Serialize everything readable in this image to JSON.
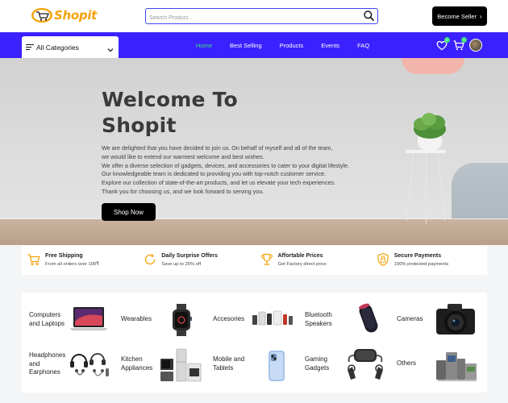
{
  "header": {
    "logo_text": "Shopit",
    "search_placeholder": "Search Product...",
    "become_seller_label": "Become Seller",
    "become_seller_chevron": "›"
  },
  "nav": {
    "categories_label": "All Categories",
    "links": [
      {
        "label": "Home",
        "active": true
      },
      {
        "label": "Best Selling",
        "active": false
      },
      {
        "label": "Products",
        "active": false
      },
      {
        "label": "Events",
        "active": false
      },
      {
        "label": "FAQ",
        "active": false
      }
    ],
    "wishlist_count": "0",
    "cart_count": "0",
    "active_color": "#37e07a",
    "bar_color": "#3b21ff"
  },
  "hero": {
    "title_line1": "Welcome To",
    "title_line2": "Shopit",
    "text_lines": [
      "We are delighted that you have decided to join us. On behalf of myself and all of the team,",
      "we would like to extend our warmest welcome and best wishes.",
      "We offer a diverse selection of gadgets, devices, and accessories to cater to your digital lifestyle.",
      "Our knowledgeable team is dedicated to providing you with top-notch customer service.",
      "Explore our collection of state-of-the-art products, and let us elevate your tech experiences.",
      "Thank you for choosing us, and we look forward to serving you."
    ],
    "button_label": "Shop Now"
  },
  "features": [
    {
      "title": "Free Shipping",
      "subtitle": "From all orders over 100₹",
      "icon": "cart-icon"
    },
    {
      "title": "Daily Surprise Offers",
      "subtitle": "Save up to 25% off",
      "icon": "refresh-icon"
    },
    {
      "title": "Affortable Prices",
      "subtitle": "Get Factory direct price",
      "icon": "trophy-icon"
    },
    {
      "title": "Secure Payments",
      "subtitle": "100% protected payments",
      "icon": "shield-icon"
    }
  ],
  "categories": [
    {
      "name_lines": [
        "Computers",
        "and Laptops"
      ],
      "icon": "laptop-icon"
    },
    {
      "name_lines": [
        "Wearables"
      ],
      "icon": "smartwatch-icon"
    },
    {
      "name_lines": [
        "Accesories"
      ],
      "icon": "accessories-icon"
    },
    {
      "name_lines": [
        "Bluetooth",
        "Speakers"
      ],
      "icon": "speaker-icon"
    },
    {
      "name_lines": [
        "Cameras"
      ],
      "icon": "camera-icon"
    },
    {
      "name_lines": [
        "Headphones",
        "and",
        "Earphones"
      ],
      "icon": "headphones-icon"
    },
    {
      "name_lines": [
        "Kitchen",
        "Appliances"
      ],
      "icon": "kitchen-appliances-icon"
    },
    {
      "name_lines": [
        "Mobile and",
        "Tablets"
      ],
      "icon": "phone-icon"
    },
    {
      "name_lines": [
        "Gaming",
        "Gadgets"
      ],
      "icon": "vr-headset-icon"
    },
    {
      "name_lines": [
        "Others"
      ],
      "icon": "others-icon"
    }
  ],
  "colors": {
    "accent_orange": "#f5a20a",
    "primary_blue": "#3b21ff",
    "search_border": "#3b46f0",
    "feature_icon": "#f5a20a"
  }
}
